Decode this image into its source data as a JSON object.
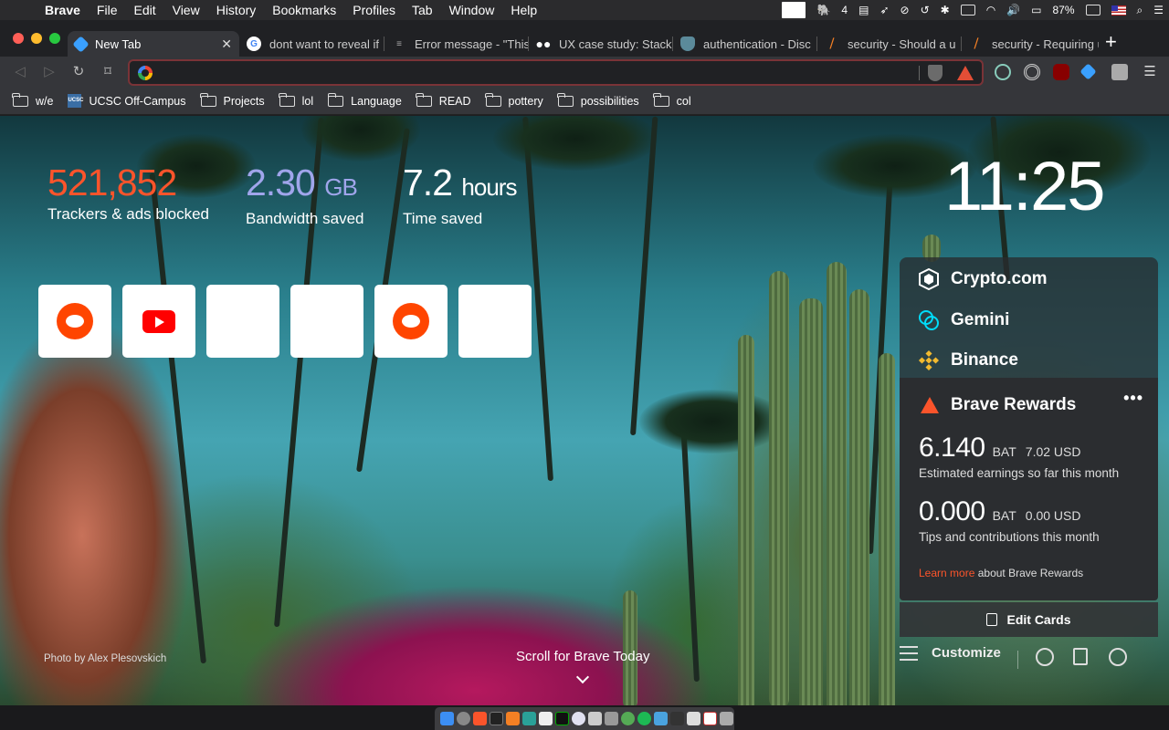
{
  "menubar": {
    "app": "Brave",
    "items": [
      "File",
      "Edit",
      "View",
      "History",
      "Bookmarks",
      "Profiles",
      "Tab",
      "Window",
      "Help"
    ],
    "status": {
      "notification_count": "4",
      "battery": "87%"
    }
  },
  "tabs": [
    {
      "title": "New Tab",
      "favicon": "brave-gem-icon",
      "active": true
    },
    {
      "title": "dont want to reveal if",
      "favicon": "google-icon"
    },
    {
      "title": "Error message - \"This",
      "favicon": "stackexchange-icon"
    },
    {
      "title": "UX case study: Stack",
      "favicon": "medium-icon"
    },
    {
      "title": "authentication - Disc",
      "favicon": "security-se-icon"
    },
    {
      "title": "security - Should a u",
      "favicon": "stackoverflow-icon"
    },
    {
      "title": "security - Requiring u",
      "favicon": "stackoverflow-icon"
    }
  ],
  "omnibox": {
    "value": "",
    "placeholder": ""
  },
  "bookmarks": [
    {
      "label": "w/e",
      "type": "folder"
    },
    {
      "label": "UCSC Off-Campus",
      "type": "site"
    },
    {
      "label": "Projects",
      "type": "folder"
    },
    {
      "label": "lol",
      "type": "folder"
    },
    {
      "label": "Language",
      "type": "folder"
    },
    {
      "label": "READ",
      "type": "folder"
    },
    {
      "label": "pottery",
      "type": "folder"
    },
    {
      "label": "possibilities",
      "type": "folder"
    },
    {
      "label": "col",
      "type": "folder"
    }
  ],
  "stats": {
    "trackers": {
      "value": "521,852",
      "label": "Trackers & ads blocked",
      "color": "#fb542b"
    },
    "bandwidth": {
      "value": "2.30",
      "unit": "GB",
      "label": "Bandwidth saved",
      "color": "#a0a5eb"
    },
    "time": {
      "value": "7.2",
      "unit": "hours",
      "label": "Time saved",
      "color": "#ffffff"
    }
  },
  "clock": "11:25",
  "top_sites": [
    {
      "icon": "reddit-icon"
    },
    {
      "icon": "youtube-icon"
    },
    {
      "icon": ""
    },
    {
      "icon": ""
    },
    {
      "icon": "reddit-icon"
    },
    {
      "icon": ""
    }
  ],
  "photo_credit": "Photo by Alex Plesovskich",
  "brave_today": "Scroll for Brave Today",
  "exchanges": [
    "Crypto.com",
    "Gemini",
    "Binance"
  ],
  "rewards": {
    "title": "Brave Rewards",
    "earnings": {
      "bat": "6.140",
      "bat_unit": "BAT",
      "usd": "7.02 USD",
      "label": "Estimated earnings so far this month"
    },
    "tips": {
      "bat": "0.000",
      "bat_unit": "BAT",
      "usd": "0.00 USD",
      "label": "Tips and contributions this month"
    },
    "learn_link": "Learn more",
    "learn_rest": "about Brave Rewards"
  },
  "edit_cards": "Edit Cards",
  "customize": "Customize"
}
